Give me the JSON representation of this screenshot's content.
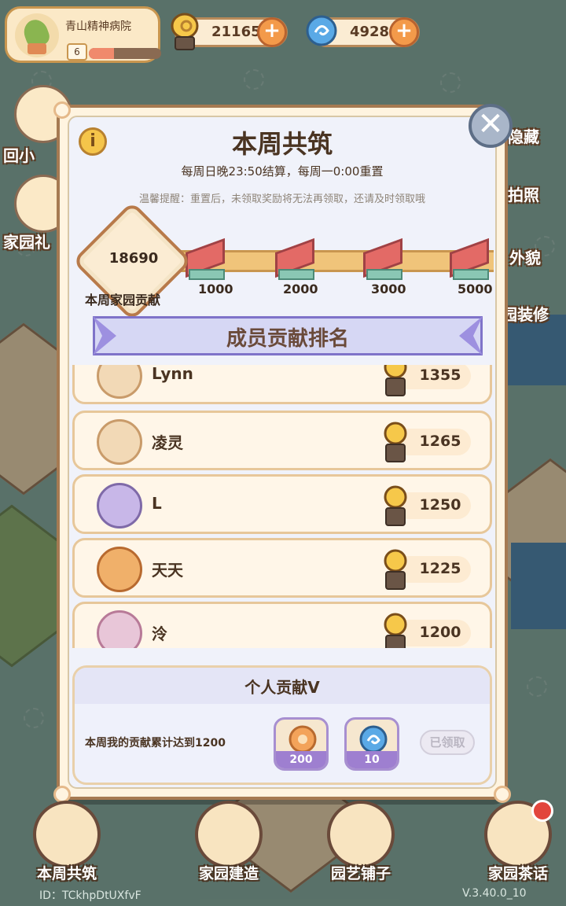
{
  "header": {
    "home_name": "青山精神病院",
    "level": "6",
    "level_progress": 0.35,
    "coin": "21165",
    "gem": "4928"
  },
  "side_left": [
    {
      "label": "回小"
    },
    {
      "label": "家园礼"
    }
  ],
  "side_right": [
    {
      "label": "隐藏"
    },
    {
      "label": "拍照"
    },
    {
      "label": "外貌"
    },
    {
      "label": "园装修"
    }
  ],
  "panel": {
    "title": "本周共筑",
    "schedule": "每周日晚23:50结算，每周一0:00重置",
    "tip": "温馨提醒：重置后，未领取奖励将无法再领取，还请及时领取哦",
    "total_contribution": "18690",
    "total_label": "本周家园贡献",
    "milestones": [
      "1000",
      "2000",
      "3000",
      "5000"
    ],
    "ranking_title": "成员贡献排名",
    "ranking": [
      {
        "name": "Lynn",
        "score": "1355"
      },
      {
        "name": "凌灵",
        "score": "1265"
      },
      {
        "name": "L",
        "score": "1250"
      },
      {
        "name": "天天",
        "score": "1225"
      },
      {
        "name": "泠",
        "score": "1200"
      }
    ],
    "personal": {
      "title": "个人贡献V",
      "desc": "本周我的贡献累计达到1200",
      "reward1": "200",
      "reward2": "10",
      "claimed": "已领取"
    }
  },
  "bottom_nav": [
    {
      "label": "本周共筑"
    },
    {
      "label": "家园建造"
    },
    {
      "label": "园艺铺子"
    },
    {
      "label": "家园茶话"
    }
  ],
  "footer": {
    "id": "ID：TCkhpDtUXfvF",
    "version": "V.3.40.0_10"
  },
  "colors": {
    "panel_bg": "#f0f2fa",
    "banner_purple": "#7f73c9",
    "reward_purple": "#9e7fd0",
    "ribbon_red": "#e36a66"
  }
}
